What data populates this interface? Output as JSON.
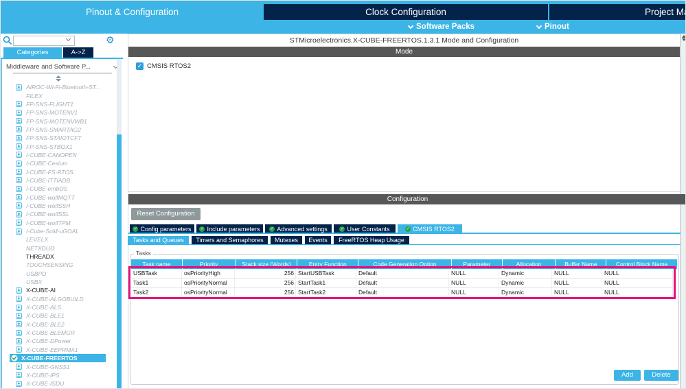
{
  "colors": {
    "accent": "#3CB4E6",
    "navy": "#03234b",
    "bar_gray": "#575757",
    "annotation_pink": "#e4127c",
    "check_green": "#27a347"
  },
  "top_nav": {
    "tabs": [
      {
        "label": "Pinout & Configuration",
        "active": true
      },
      {
        "label": "Clock Configuration",
        "active": false
      },
      {
        "label": "Project Ma",
        "active": false
      }
    ],
    "sub_bar": [
      {
        "label": "Software Packs"
      },
      {
        "label": "Pinout"
      }
    ]
  },
  "sidebar": {
    "search": {
      "value": "",
      "placeholder": ""
    },
    "tabs": [
      {
        "label": "Categories",
        "active": true
      },
      {
        "label": "A->Z",
        "active": false
      }
    ],
    "section_header": "Middleware and Software P...",
    "items": [
      {
        "label": "AIROC-Wi-Fi-Bluetooth-ST...",
        "icon": "download",
        "state": "available"
      },
      {
        "label": "FILEX",
        "icon": "none",
        "state": "available"
      },
      {
        "label": "FP-SNS-FLIGHT1",
        "icon": "download",
        "state": "available"
      },
      {
        "label": "FP-SNS-MOTENV1",
        "icon": "download",
        "state": "available"
      },
      {
        "label": "FP-SNS-MOTENVWB1",
        "icon": "download",
        "state": "available"
      },
      {
        "label": "FP-SNS-SMARTAG2",
        "icon": "download",
        "state": "available"
      },
      {
        "label": "FP-SNS-STAIOTCFT",
        "icon": "download",
        "state": "available"
      },
      {
        "label": "FP-SNS-STBOX1",
        "icon": "download",
        "state": "available"
      },
      {
        "label": "I-CUBE-CANOPEN",
        "icon": "download",
        "state": "available"
      },
      {
        "label": "I-CUBE-Cesium",
        "icon": "download",
        "state": "available"
      },
      {
        "label": "I-CUBE-FS-RTOS",
        "icon": "download",
        "state": "available"
      },
      {
        "label": "I-CUBE-ITTIADB",
        "icon": "download",
        "state": "available"
      },
      {
        "label": "I-CUBE-embOS",
        "icon": "download",
        "state": "available"
      },
      {
        "label": "I-CUBE-wolfMQTT",
        "icon": "download",
        "state": "available"
      },
      {
        "label": "I-CUBE-wolfSSH",
        "icon": "download",
        "state": "available"
      },
      {
        "label": "I-CUBE-wolfSSL",
        "icon": "download",
        "state": "available"
      },
      {
        "label": "I-CUBE-wolfTPM",
        "icon": "download",
        "state": "available"
      },
      {
        "label": "I-Cube-SoM-uGOAL",
        "icon": "download",
        "state": "available"
      },
      {
        "label": "LEVELX",
        "icon": "none",
        "state": "available"
      },
      {
        "label": "NETXDUO",
        "icon": "none",
        "state": "available"
      },
      {
        "label": "THREADX",
        "icon": "none",
        "state": "installed"
      },
      {
        "label": "TOUCHSENSING",
        "icon": "none",
        "state": "available"
      },
      {
        "label": "USBPD",
        "icon": "none",
        "state": "available"
      },
      {
        "label": "USBX",
        "icon": "none",
        "state": "available"
      },
      {
        "label": "X-CUBE-AI",
        "icon": "download",
        "state": "installed"
      },
      {
        "label": "X-CUBE-ALGOBUILD",
        "icon": "download",
        "state": "available"
      },
      {
        "label": "X-CUBE-ALS",
        "icon": "download",
        "state": "available"
      },
      {
        "label": "X-CUBE-BLE1",
        "icon": "download",
        "state": "available"
      },
      {
        "label": "X-CUBE-BLE2",
        "icon": "download",
        "state": "available"
      },
      {
        "label": "X-CUBE-BLEMGR",
        "icon": "download",
        "state": "available"
      },
      {
        "label": "X-CUBE-DPower",
        "icon": "download",
        "state": "available"
      },
      {
        "label": "X-CUBE-EEPRMA1",
        "icon": "download",
        "state": "available"
      },
      {
        "label": "X-CUBE-FREERTOS",
        "icon": "check",
        "state": "selected"
      },
      {
        "label": "X-CUBE-GNSS1",
        "icon": "download",
        "state": "available"
      },
      {
        "label": "X-CUBE-IPS",
        "icon": "download",
        "state": "available"
      },
      {
        "label": "X-CUBE-ISDU",
        "icon": "download",
        "state": "available"
      }
    ]
  },
  "main": {
    "title": "STMicroelectronics.X-CUBE-FREERTOS.1.3.1 Mode and Configuration",
    "mode": {
      "header": "Mode",
      "checkbox_label": "CMSIS RTOS2",
      "checked": true
    },
    "configuration": {
      "header": "Configuration",
      "reset_button": "Reset Configuration",
      "tabs_row1": [
        {
          "label": "Config parameters",
          "active": false
        },
        {
          "label": "Include parameters",
          "active": false
        },
        {
          "label": "Advanced settings",
          "active": false
        },
        {
          "label": "User Constants",
          "active": false
        },
        {
          "label": "CMSIS RTOS2",
          "active": true
        }
      ],
      "tabs_row2": [
        {
          "label": "Tasks and Queues",
          "active": true
        },
        {
          "label": "Timers and Semaphores",
          "active": false
        },
        {
          "label": "Mutexes",
          "active": false
        },
        {
          "label": "Events",
          "active": false
        },
        {
          "label": "FreeRTOS Heap Usage",
          "active": false
        }
      ],
      "tasks_group": {
        "label": "Tasks",
        "table": {
          "columns": [
            "Task name",
            "Priority",
            "Stack size (Words)",
            "Entry Function",
            "Code Generation Option",
            "Parameter",
            "Allocation",
            "Buffer Name",
            "Control Block Name"
          ],
          "rows": [
            [
              "USBTask",
              "osPriorityHigh",
              "256",
              "StartUSBTask",
              "Default",
              "NULL",
              "Dynamic",
              "NULL",
              "NULL"
            ],
            [
              "Task1",
              "osPriorityNormal",
              "256",
              "StartTask1",
              "Default",
              "NULL",
              "Dynamic",
              "NULL",
              "NULL"
            ],
            [
              "Task2",
              "osPriorityNormal",
              "256",
              "StartTask2",
              "Default",
              "NULL",
              "Dynamic",
              "NULL",
              "NULL"
            ]
          ]
        },
        "add_button": "Add",
        "delete_button": "Delete"
      }
    }
  }
}
